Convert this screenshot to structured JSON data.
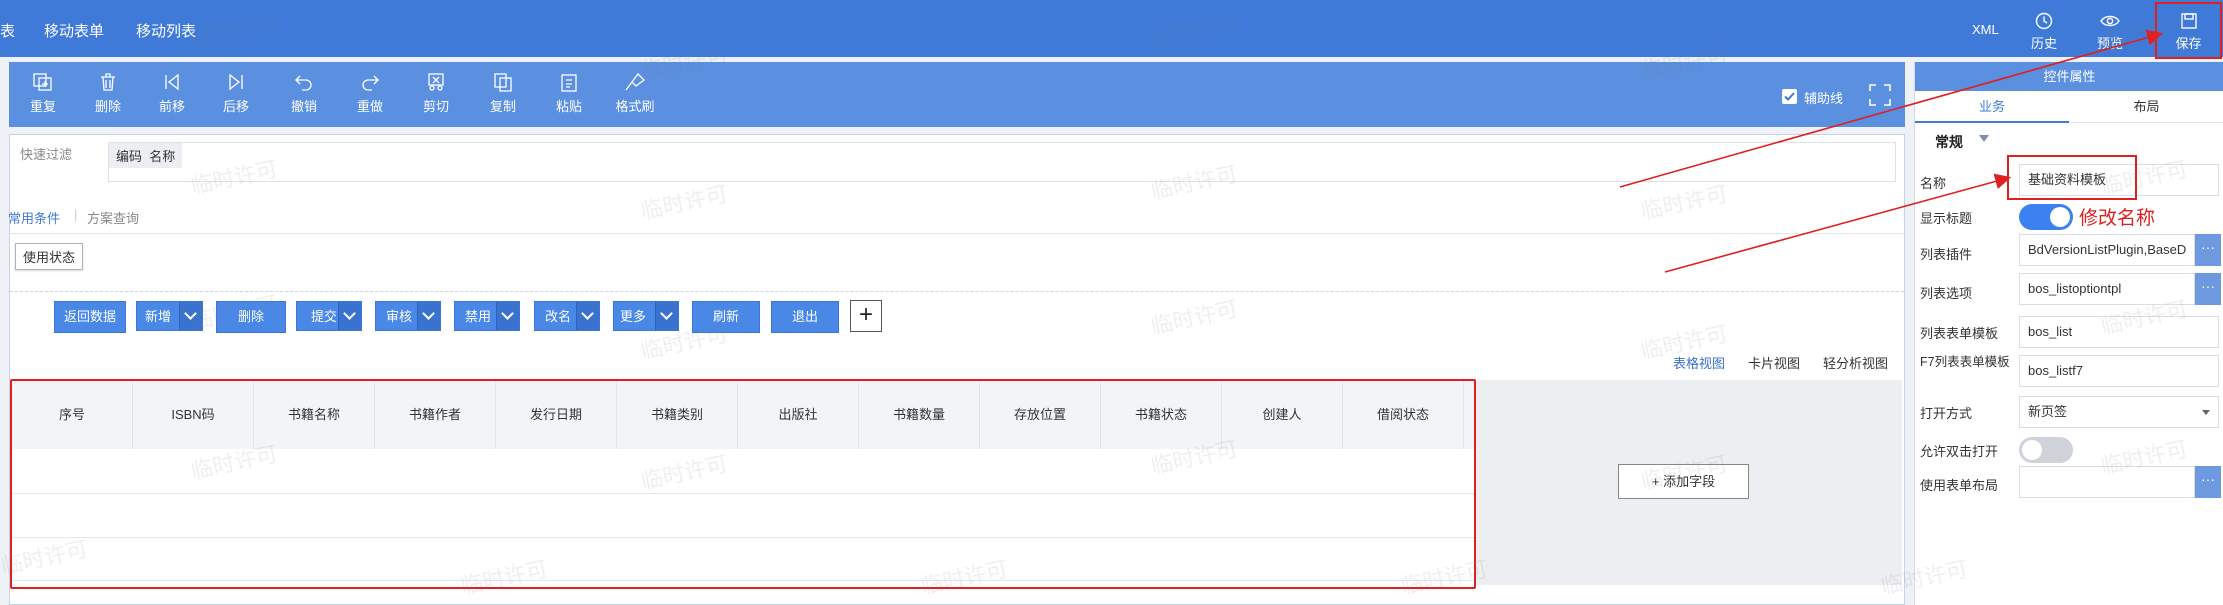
{
  "nav": {
    "tab_partial": "表",
    "tabs": [
      "移动表单",
      "移动列表"
    ],
    "xml": "XML",
    "history": "历史",
    "preview": "预览",
    "save": "保存"
  },
  "toolbar": {
    "buttons": [
      "重复",
      "删除",
      "前移",
      "后移",
      "撤销",
      "重做",
      "剪切",
      "复制",
      "粘贴",
      "格式刷"
    ],
    "helper_line": "辅助线"
  },
  "filter": {
    "quick_filter": "快速过滤",
    "chip_code": "编码",
    "chip_name": "名称",
    "common_tab": "常用条件",
    "scheme_tab": "方案查询",
    "status_chip": "使用状态"
  },
  "actions": {
    "back": "返回数据",
    "add": "新增",
    "delete": "删除",
    "submit": "提交",
    "audit": "审核",
    "disable": "禁用",
    "rename": "改名",
    "more": "更多",
    "refresh": "刷新",
    "exit": "退出",
    "plus": "+"
  },
  "views": {
    "table": "表格视图",
    "card": "卡片视图",
    "light": "轻分析视图"
  },
  "grid": {
    "columns": [
      "序号",
      "ISBN码",
      "书籍名称",
      "书籍作者",
      "发行日期",
      "书籍类别",
      "出版社",
      "书籍数量",
      "存放位置",
      "书籍状态",
      "创建人",
      "借阅状态"
    ],
    "add_field": "+ 添加字段"
  },
  "panel": {
    "title": "控件属性",
    "tab_business": "业务",
    "tab_layout": "布局",
    "section": "常规",
    "rows": {
      "name_label": "名称",
      "name_value": "基础资料模板",
      "show_title_label": "显示标题",
      "plugin_label": "列表插件",
      "plugin_value": "BdVersionListPlugin,BaseD",
      "options_label": "列表选项",
      "options_value": "bos_listoptiontpl",
      "form_tpl_label": "列表表单模板",
      "form_tpl_value": "bos_list",
      "f7_label": "F7列表表单模板",
      "f7_value": "bos_listf7",
      "open_label": "打开方式",
      "open_value": "新页签",
      "dblclick_label": "允许双击打开",
      "use_layout_label": "使用表单布局",
      "use_layout_value": ""
    },
    "more_glyph": "···"
  },
  "annotation": {
    "text": "修改名称",
    "color": "#e02020"
  },
  "watermark": "临时许可",
  "colors": {
    "nav": "#3f7ad9",
    "toolbar": "#5b8fe0",
    "button": "#4a88e8",
    "toggle_on": "#3b82f0",
    "toggle_off": "#cfd3d9"
  }
}
